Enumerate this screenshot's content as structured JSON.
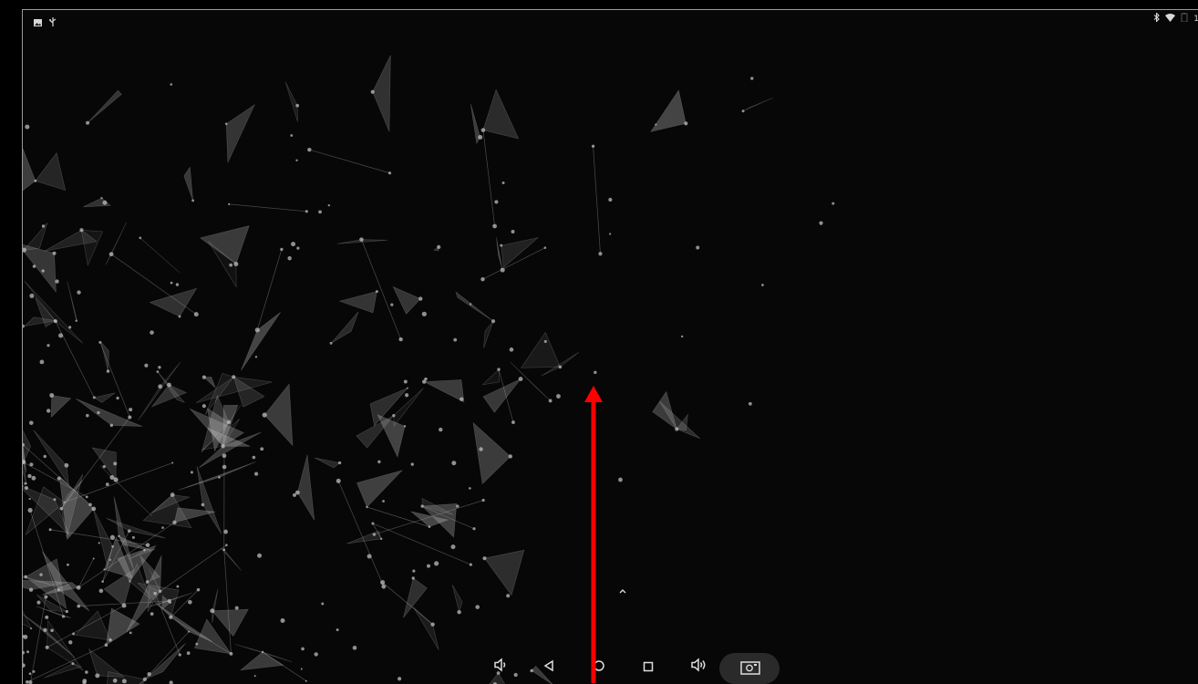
{
  "status_bar": {
    "left_icons": [
      "image-icon",
      "usb-icon"
    ],
    "right_icons": [
      "bluetooth-icon",
      "wifi-icon",
      "battery-icon"
    ],
    "time_partial": "1"
  },
  "navigation_bar": {
    "buttons": [
      "volume-down-icon",
      "back-icon",
      "home-icon",
      "recents-icon",
      "volume-up-icon",
      "screenshot-icon"
    ]
  },
  "overlay": {
    "arrow_color": "#ff0000",
    "arrow_direction": "up"
  },
  "colors": {
    "background": "#070707",
    "network": "#cfcfcf",
    "pill": "#2a2a2a"
  }
}
